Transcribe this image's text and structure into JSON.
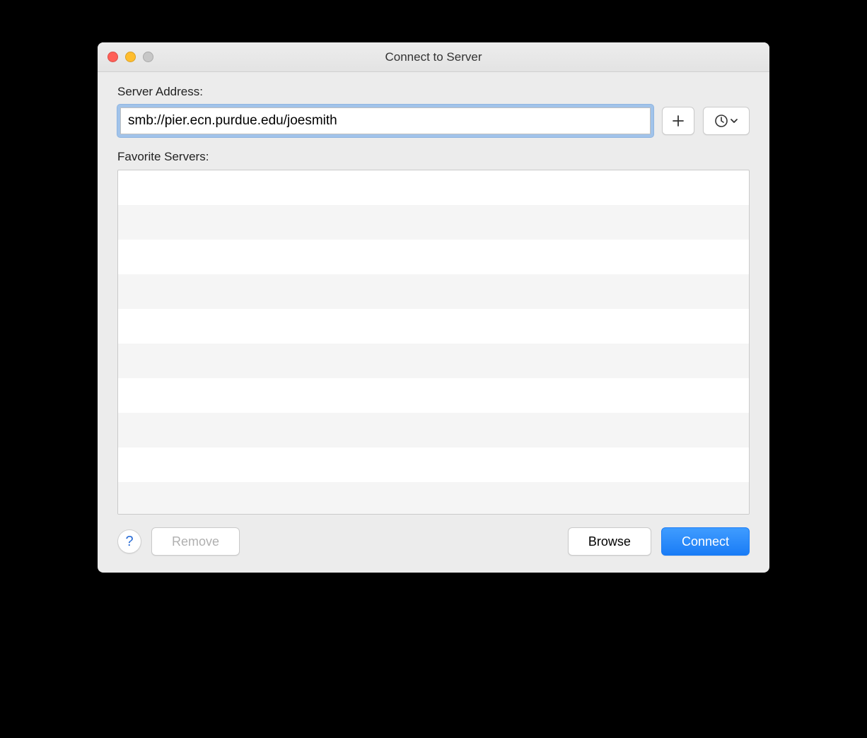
{
  "window": {
    "title": "Connect to Server"
  },
  "labels": {
    "server_address": "Server Address:",
    "favorite_servers": "Favorite Servers:"
  },
  "address": {
    "value": "smb://pier.ecn.purdue.edu/joesmith"
  },
  "buttons": {
    "add_icon": "plus-icon",
    "history_icon": "clock-icon",
    "help": "?",
    "remove": "Remove",
    "browse": "Browse",
    "connect": "Connect"
  },
  "favorites": {
    "row_count": 10,
    "items": []
  }
}
